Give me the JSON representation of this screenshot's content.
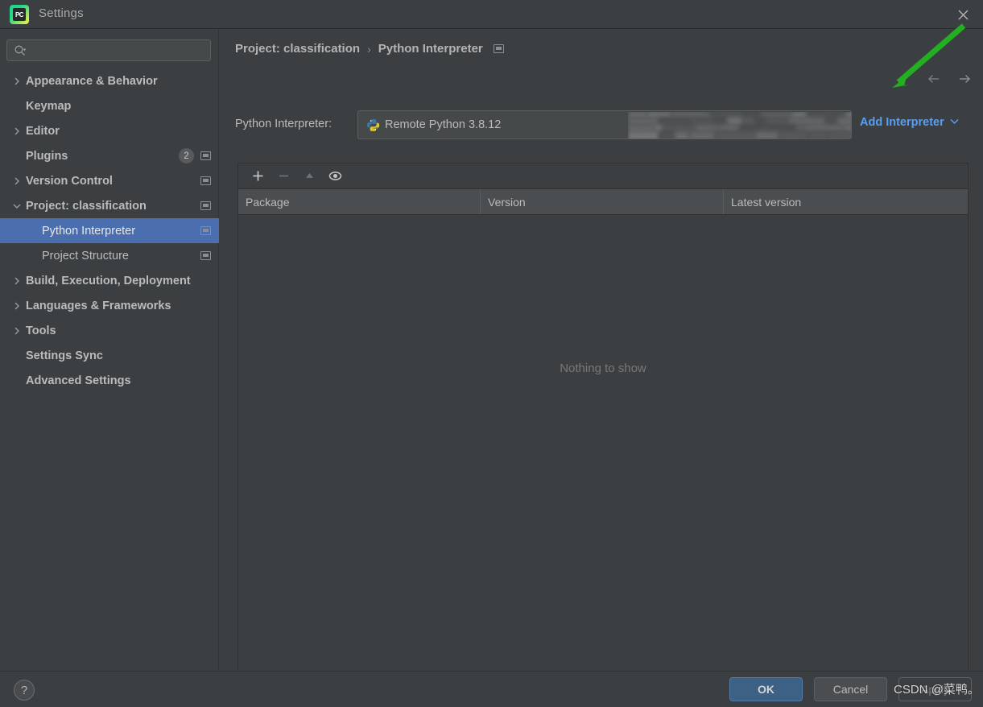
{
  "window": {
    "title": "Settings",
    "app_icon": "pycharm-logo-icon",
    "close_icon": "close-icon"
  },
  "sidebar": {
    "search": {
      "placeholder": "",
      "value": "",
      "icon": "search-icon"
    },
    "items": [
      {
        "label": "Appearance & Behavior",
        "arrow": "chevron-right",
        "bold": true,
        "indent": false,
        "badge": null,
        "chip": false
      },
      {
        "label": "Keymap",
        "arrow": "none",
        "bold": true,
        "indent": false,
        "badge": null,
        "chip": false
      },
      {
        "label": "Editor",
        "arrow": "chevron-right",
        "bold": true,
        "indent": false,
        "badge": null,
        "chip": false
      },
      {
        "label": "Plugins",
        "arrow": "none",
        "bold": true,
        "indent": false,
        "badge": "2",
        "chip": true
      },
      {
        "label": "Version Control",
        "arrow": "chevron-right",
        "bold": true,
        "indent": false,
        "badge": null,
        "chip": true
      },
      {
        "label": "Project: classification",
        "arrow": "chevron-down",
        "bold": true,
        "indent": false,
        "badge": null,
        "chip": true
      },
      {
        "label": "Python Interpreter",
        "arrow": "none",
        "bold": false,
        "indent": true,
        "badge": null,
        "chip": true,
        "selected": true
      },
      {
        "label": "Project Structure",
        "arrow": "none",
        "bold": false,
        "indent": true,
        "badge": null,
        "chip": true
      },
      {
        "label": "Build, Execution, Deployment",
        "arrow": "chevron-right",
        "bold": true,
        "indent": false,
        "badge": null,
        "chip": false
      },
      {
        "label": "Languages & Frameworks",
        "arrow": "chevron-right",
        "bold": true,
        "indent": false,
        "badge": null,
        "chip": false
      },
      {
        "label": "Tools",
        "arrow": "chevron-right",
        "bold": true,
        "indent": false,
        "badge": null,
        "chip": false
      },
      {
        "label": "Settings Sync",
        "arrow": "none",
        "bold": true,
        "indent": false,
        "badge": null,
        "chip": false
      },
      {
        "label": "Advanced Settings",
        "arrow": "none",
        "bold": true,
        "indent": false,
        "badge": null,
        "chip": false
      }
    ]
  },
  "main": {
    "breadcrumb": {
      "parent": "Project: classification",
      "separator": "›",
      "current": "Python Interpreter"
    },
    "nav": {
      "back_icon": "arrow-left-icon",
      "forward_icon": "arrow-right-icon"
    },
    "interpreter": {
      "label": "Python Interpreter:",
      "value": "Remote Python 3.8.12",
      "icon": "python-icon",
      "redacted": true
    },
    "add_interpreter": {
      "label": "Add Interpreter",
      "caret": "⌄"
    },
    "toolbar": [
      {
        "name": "add-package-button",
        "glyph": "+",
        "enabled": true
      },
      {
        "name": "remove-package-button",
        "glyph": "−",
        "enabled": false
      },
      {
        "name": "upgrade-package-button",
        "glyph": "▲",
        "enabled": false
      },
      {
        "name": "show-early-releases-button",
        "glyph": "eye",
        "enabled": true
      }
    ],
    "table": {
      "columns": [
        "Package",
        "Version",
        "Latest version"
      ],
      "rows": [],
      "empty_text": "Nothing to show"
    }
  },
  "footer": {
    "help_label": "?",
    "buttons": [
      {
        "label": "OK",
        "primary": true
      },
      {
        "label": "Cancel",
        "primary": false
      },
      {
        "label": "Apply",
        "primary": false,
        "disabled": true
      }
    ]
  },
  "overlay": {
    "watermark": "CSDN @菜鸭。",
    "annotation_arrow_color": "#22b022"
  }
}
